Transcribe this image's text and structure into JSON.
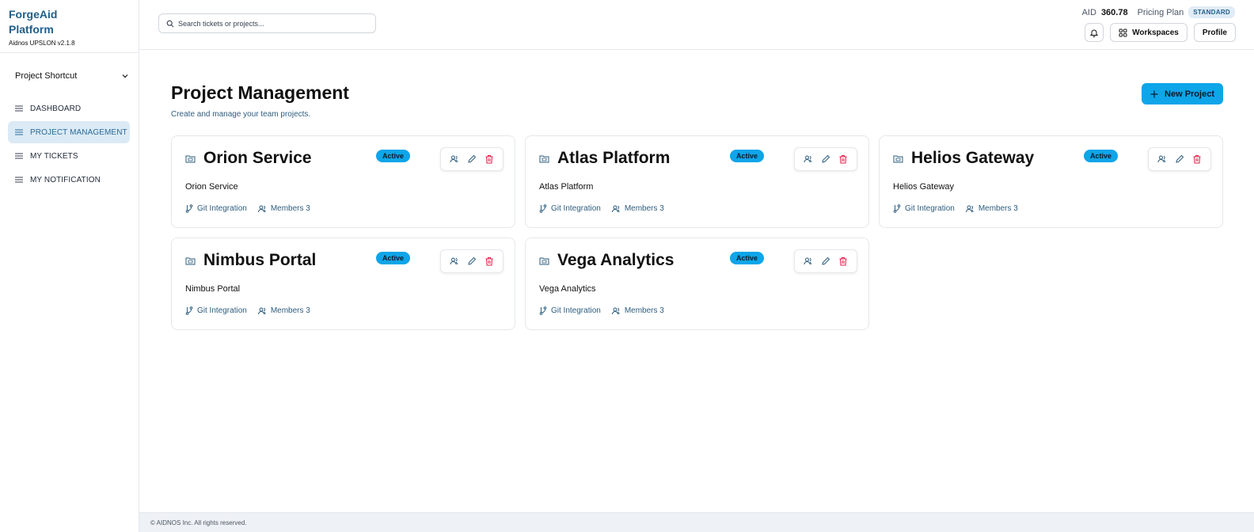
{
  "brand": {
    "title": "ForgeAid Platform",
    "version": "Aidnos UPSLON v2.1.8"
  },
  "sidebar": {
    "shortcut_label": "Project Shortcut",
    "items": [
      {
        "label": "DASHBOARD",
        "active": false
      },
      {
        "label": "PROJECT MANAGEMENT",
        "active": true
      },
      {
        "label": "MY TICKETS",
        "active": false
      },
      {
        "label": "MY NOTIFICATION",
        "active": false
      }
    ]
  },
  "header": {
    "search_placeholder": "Search tickets or projects...",
    "aid_label": "AID",
    "aid_value": "360.78",
    "plan_label": "Pricing Plan",
    "plan_value": "STANDARD",
    "workspaces_label": "Workspaces",
    "profile_label": "Profile"
  },
  "main": {
    "title": "Project Management",
    "subtitle": "Create and manage your team projects.",
    "new_project_label": "New Project",
    "projects": [
      {
        "name": "Orion Service",
        "description": "Orion Service",
        "status": "Active",
        "git_label": "Git Integration",
        "members_label": "Members 3"
      },
      {
        "name": "Atlas Platform",
        "description": "Atlas Platform",
        "status": "Active",
        "git_label": "Git Integration",
        "members_label": "Members 3"
      },
      {
        "name": "Helios Gateway",
        "description": "Helios Gateway",
        "status": "Active",
        "git_label": "Git Integration",
        "members_label": "Members 3"
      },
      {
        "name": "Nimbus Portal",
        "description": "Nimbus Portal",
        "status": "Active",
        "git_label": "Git Integration",
        "members_label": "Members 3"
      },
      {
        "name": "Vega Analytics",
        "description": "Vega Analytics",
        "status": "Active",
        "git_label": "Git Integration",
        "members_label": "Members 3"
      }
    ]
  },
  "footer": {
    "text": "© AIDNOS Inc. All rights reserved."
  },
  "colors": {
    "accent": "#0ea5e9",
    "brand": "#1f5f8b",
    "active_nav_bg": "#dbeaf5",
    "danger": "#e11d48"
  }
}
